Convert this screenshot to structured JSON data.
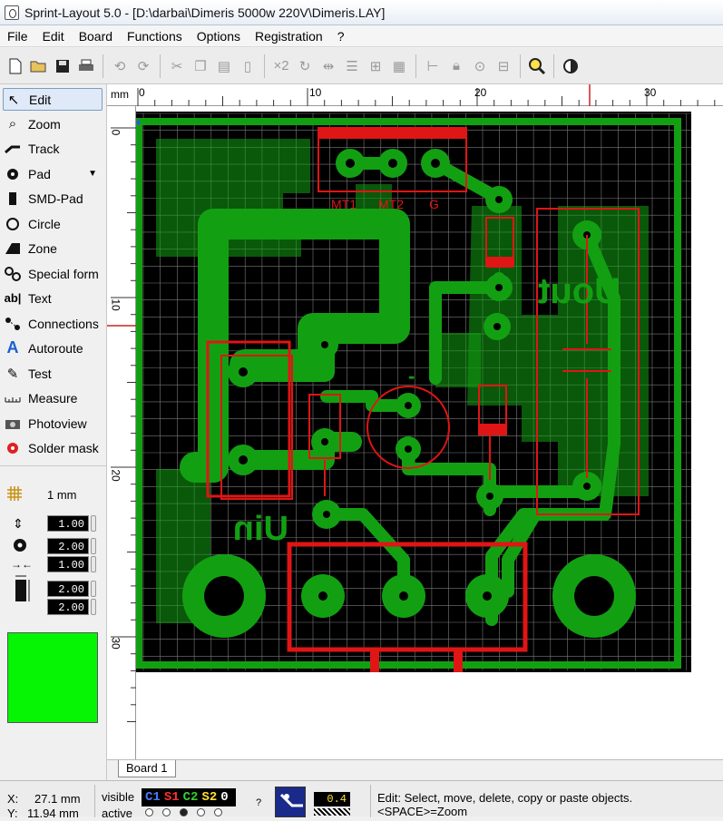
{
  "window": {
    "title": "Sprint-Layout 5.0 - [D:\\darbai\\Dimeris 5000w 220V\\Dimeris.LAY]"
  },
  "menu": [
    "File",
    "Edit",
    "Board",
    "Functions",
    "Options",
    "Registration",
    "?"
  ],
  "toolbar": {
    "icons": [
      "new-file-icon",
      "open-folder-icon",
      "save-icon",
      "print-icon",
      "undo-icon",
      "redo-icon",
      "cut-icon",
      "copy-icon",
      "paste-icon",
      "delete-icon",
      "x2-icon",
      "rotate-icon",
      "mirror-icon",
      "align-icon",
      "group-icon",
      "ungroup-icon",
      "pattern-icon",
      "tree-icon",
      "lock-icon",
      "camera-icon",
      "zoom-icon",
      "contrast-icon"
    ],
    "x2_label": "×2"
  },
  "tools": [
    {
      "label": "Edit",
      "icon": "cursor-arrow-icon",
      "selected": true
    },
    {
      "label": "Zoom",
      "icon": "magnifier-icon"
    },
    {
      "label": "Track",
      "icon": "track-icon"
    },
    {
      "label": "Pad",
      "icon": "pad-icon",
      "dropdown": true
    },
    {
      "label": "SMD-Pad",
      "icon": "smd-pad-icon"
    },
    {
      "label": "Circle",
      "icon": "circle-icon"
    },
    {
      "label": "Zone",
      "icon": "zone-icon"
    },
    {
      "label": "Special form",
      "icon": "special-form-icon"
    },
    {
      "label": "Text",
      "icon": "text-icon"
    },
    {
      "label": "Connections",
      "icon": "connections-icon"
    },
    {
      "label": "Autoroute",
      "icon": "autoroute-icon"
    },
    {
      "label": "Test",
      "icon": "test-probe-icon"
    },
    {
      "label": "Measure",
      "icon": "measure-icon"
    },
    {
      "label": "Photoview",
      "icon": "camera-icon"
    },
    {
      "label": "Solder mask",
      "icon": "solder-mask-icon"
    }
  ],
  "grid": {
    "label": "1 mm"
  },
  "track_width": "1.00",
  "pad_outer": "2.00",
  "pad_inner": "1.00",
  "smd_width": "2.00",
  "smd_height": "2.00",
  "layer_color": "#05f505",
  "ruler": {
    "unit": "mm",
    "top_labels": [
      "0",
      "10",
      "20",
      "30"
    ],
    "left_labels": [
      "0",
      "10",
      "20",
      "30"
    ]
  },
  "board": {
    "copper_color": "#12a012",
    "silk_color": "#e01515",
    "labels": {
      "uout": "Uout",
      "uin": "Uin",
      "mt1": "MT1",
      "mt2": "MT2",
      "g": "G",
      "minus": "-"
    }
  },
  "tabs": {
    "board1": "Board 1"
  },
  "status": {
    "x_label": "X:",
    "x_value": "27.1 mm",
    "y_label": "Y:",
    "y_value": "11.94 mm",
    "visible_label": "visible",
    "active_label": "active",
    "layers": [
      {
        "name": "C1",
        "color": "#4a7aff"
      },
      {
        "name": "S1",
        "color": "#ff3030"
      },
      {
        "name": "C2",
        "color": "#30d030"
      },
      {
        "name": "S2",
        "color": "#ffe030"
      },
      {
        "name": "0",
        "color": "#ffffff"
      }
    ],
    "help_q": "?",
    "track_value": "0.4",
    "message_line1": "Edit: Select, move, delete, copy or paste objects.",
    "message_line2": "<SPACE>=Zoom"
  }
}
